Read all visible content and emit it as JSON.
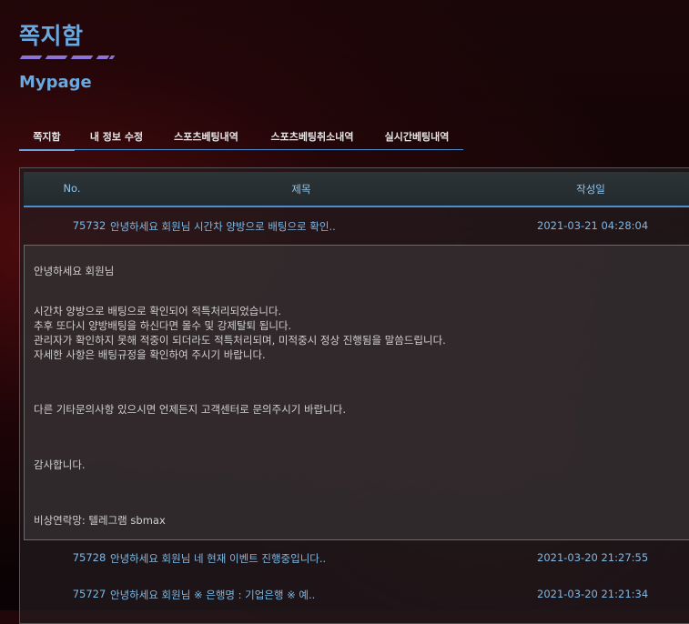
{
  "page": {
    "title": "쪽지함",
    "subtitle": "Mypage"
  },
  "tabs": [
    {
      "label": "쪽지함",
      "active": true
    },
    {
      "label": "내 정보 수정",
      "active": false
    },
    {
      "label": "스포츠베팅내역",
      "active": false
    },
    {
      "label": "스포츠베팅취소내역",
      "active": false
    },
    {
      "label": "실시간베팅내역",
      "active": false
    }
  ],
  "table": {
    "headers": {
      "no": "No.",
      "subject": "제목",
      "date": "작성일"
    },
    "rows": [
      {
        "no": "75732",
        "subject": "안녕하세요 회원님 시간차 양방으로 배팅으로 확인..",
        "date": "2021-03-21 04:28:04",
        "expanded": true
      },
      {
        "no": "75728",
        "subject": "안녕하세요 회원님 네 현재 이벤트 진행중입니다..",
        "date": "2021-03-20 21:27:55"
      },
      {
        "no": "75727",
        "subject": "안녕하세요 회원님 ※ 은행명 : 기업은행 ※ 예..",
        "date": "2021-03-20 21:21:34"
      }
    ]
  },
  "message": {
    "greeting": "안녕하세요 회원님",
    "body": [
      "시간차 양방으로 배팅으로 확인되어 적특처리되었습니다.",
      "추후 또다시 양방배팅을 하신다면 몰수 및 강제탈퇴 됩니다.",
      "관리자가 확인하지 못해 적중이 되더라도 적특처리되며, 미적중시 정상 진행됨을 말씀드립니다.",
      "자세한 사항은 배팅규정을 확인하여 주시기 바랍니다."
    ],
    "inquiry": "다른 기타문의사항 있으시면 언제든지 고객센터로 문의주시기 바랍니다.",
    "thanks": "감사합니다.",
    "contact": "비상연락망: 텔레그램 sbmax"
  },
  "colors": {
    "accent": "#6aa9e0",
    "title_bar": "#8b74d6",
    "row_text": "#7db9e6"
  }
}
